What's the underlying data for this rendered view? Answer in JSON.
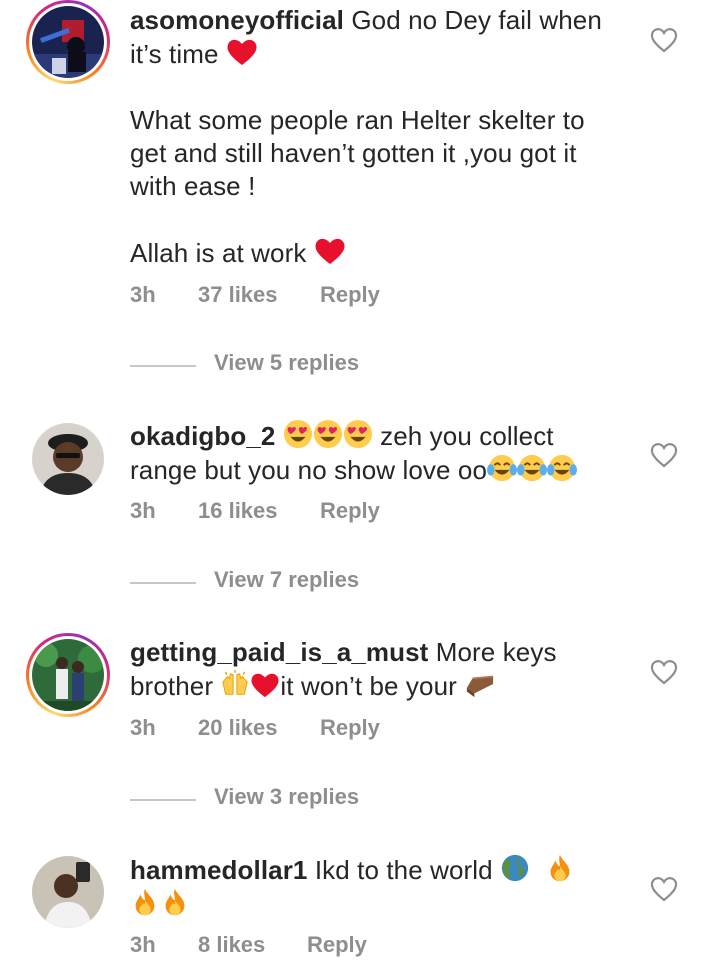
{
  "comments": [
    {
      "username": "asomoneyofficial",
      "lines": [
        "God no Dey fail when",
        "it’s time"
      ],
      "body": [
        "What some people ran Helter skelter to",
        "get and still haven’t gotten it ,you got it",
        "with ease !",
        "Allah is at work"
      ],
      "time": "3h",
      "likes": "37 likes",
      "reply": "Reply",
      "view_replies": "View 5 replies"
    },
    {
      "username": "okadigbo_2",
      "lines": [
        "zeh you collect",
        "range but you no show love oo"
      ],
      "time": "3h",
      "likes": "16 likes",
      "reply": "Reply",
      "view_replies": "View 7 replies"
    },
    {
      "username": "getting_paid_is_a_must",
      "lines": [
        "More keys",
        "brother",
        "it won’t be your"
      ],
      "time": "3h",
      "likes": "20 likes",
      "reply": "Reply",
      "view_replies": "View 3 replies"
    },
    {
      "username": "hammedollar1",
      "lines": [
        "Ikd to the world"
      ],
      "time": "3h",
      "likes": "8 likes",
      "reply": "Reply"
    }
  ],
  "icons": {
    "like": "heart-outline-icon",
    "emoji_heart": "red-heart-emoji",
    "emoji_heart_eyes": "heart-eyes-emoji",
    "emoji_joy": "tears-of-joy-emoji",
    "emoji_raised_hands": "raised-hands-emoji",
    "emoji_coffin": "coffin-emoji",
    "emoji_globe": "globe-emoji",
    "emoji_fire": "fire-emoji"
  },
  "colors": {
    "text": "#262626",
    "secondary": "#8e8e8e",
    "divider": "#c7c7c7"
  }
}
